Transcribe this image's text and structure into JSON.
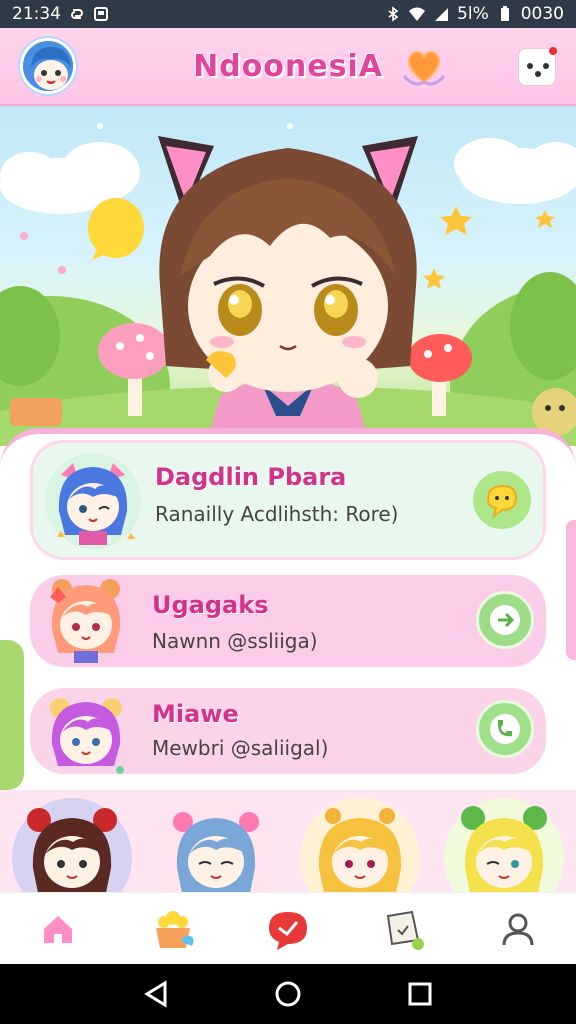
{
  "status_bar": {
    "time": "21:34",
    "battery": "5l%",
    "clock_right": "0030"
  },
  "header": {
    "title": "NdoonesiA"
  },
  "cards": [
    {
      "name": "Dagdlin Pbara",
      "subtitle": "Ranailly Acdlihsth: Rore)"
    },
    {
      "name": "Ugagaks",
      "subtitle": "Nawnn @ssliiga)"
    },
    {
      "name": "Miawe",
      "subtitle": "Mewbri @saliigal)"
    }
  ],
  "bottom_nav": [
    "home-icon",
    "gift-icon",
    "message-icon",
    "note-icon",
    "profile-icon"
  ],
  "colors": {
    "accent": "#e0449c",
    "header_bg": "#ffc6e6",
    "status_bar": "#2e3a45",
    "action_green": "#9fdc8a"
  }
}
